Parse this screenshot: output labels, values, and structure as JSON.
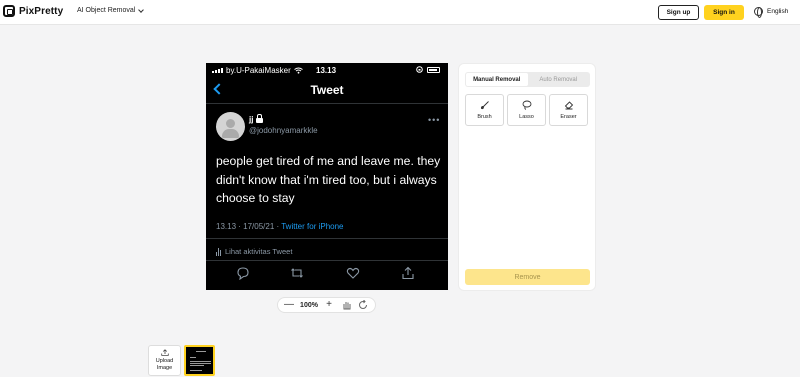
{
  "header": {
    "logo_text": "PixPretty",
    "tool_menu_label": "AI Object Removal",
    "signup_label": "Sign up",
    "signin_label": "Sign in",
    "language_label": "English",
    "signin_color": "#ffd21f"
  },
  "image": {
    "status_carrier": "by.U-PakaiMasker",
    "status_time": "13.13",
    "nav_title": "Tweet",
    "user_name": "jj",
    "user_handle": "@jodohnyamarkkle",
    "tweet_text": "people get tired of me and leave me. they didn't know that i'm tired too, but i always choose to stay",
    "timestamp": "13.13 · 17/05/21 · ",
    "source": "Twitter for iPhone",
    "activity_label": "Lihat aktivitas Tweet",
    "link_color": "#1d9bf0"
  },
  "zoom": {
    "minus": "—",
    "value": "100%",
    "plus": "+"
  },
  "panel": {
    "tabs": [
      "Manual Removal",
      "Auto Removal"
    ],
    "tools": [
      "Brush",
      "Lasso",
      "Eraser"
    ],
    "remove_label": "Remove",
    "remove_color": "#fde58c"
  },
  "thumbs": {
    "upload_label": "Upload Image"
  }
}
